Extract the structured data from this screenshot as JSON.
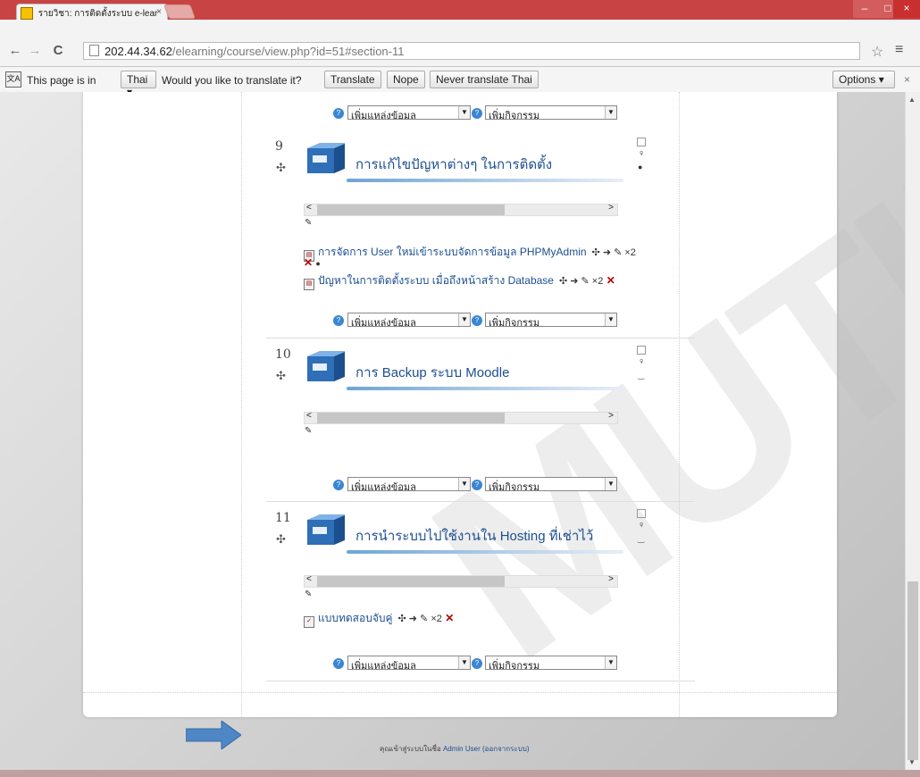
{
  "browser": {
    "tab_title": "รายวิชา: การติดตั้งระบบ e-lear",
    "tab_close": "×",
    "url_host": "202.44.34.62",
    "url_path": "/elearning/course/view.php?id=51#section-11",
    "window_min": "–",
    "window_max": "□",
    "window_close": "×",
    "back": "←",
    "forward": "→",
    "reload": "C",
    "star": "☆",
    "menu": "≡"
  },
  "translate_bar": {
    "icon": "文A",
    "prefix": "This page is in",
    "language": "Thai",
    "question": "Would you like to translate it?",
    "translate_label": "Translate",
    "nope_label": "Nope",
    "never_label": "Never translate Thai",
    "options_label": "Options",
    "close": "×"
  },
  "add_controls": {
    "resource_label": "เพิ่มแหล่งข้อมูล",
    "activity_label": "เพิ่มกิจกรรม",
    "help_glyph": "?",
    "caret": "▼"
  },
  "summary": {
    "left_arrow": "<",
    "right_arrow": ">"
  },
  "sections": [
    {
      "number": "9",
      "title": "การแก้ไขปัญหาต่างๆ ในการติดตั้ง",
      "activities": [
        {
          "label": "การจัดการ User ใหม่เข้าระบบจัดการข้อมูล PHPMyAdmin",
          "tools": "✣ ➜ ✎ ×2"
        },
        {
          "label": "ปัญหาในการติดตั้งระบบ เมื่อถึงหน้าสร้าง Database",
          "tools": "✣ ➜ ✎ ×2"
        }
      ]
    },
    {
      "number": "10",
      "title": "การ Backup ระบบ Moodle",
      "activities": []
    },
    {
      "number": "11",
      "title": "การนำระบบไปใช้งานใน Hosting ที่เช่าไว้",
      "activities": [
        {
          "label": "แบบทดสอบจับคู่",
          "tools": "✣ ➜ ✎ ×2"
        }
      ]
    }
  ],
  "footer": {
    "prefix": "คุณเข้าสู่ระบบในชื่อ",
    "user": "Admin User",
    "logout": "(ออกจากระบบ)"
  },
  "colors": {
    "title_bar": "#c84343",
    "link": "#1d4f91",
    "arrow": "#4f86c6"
  }
}
